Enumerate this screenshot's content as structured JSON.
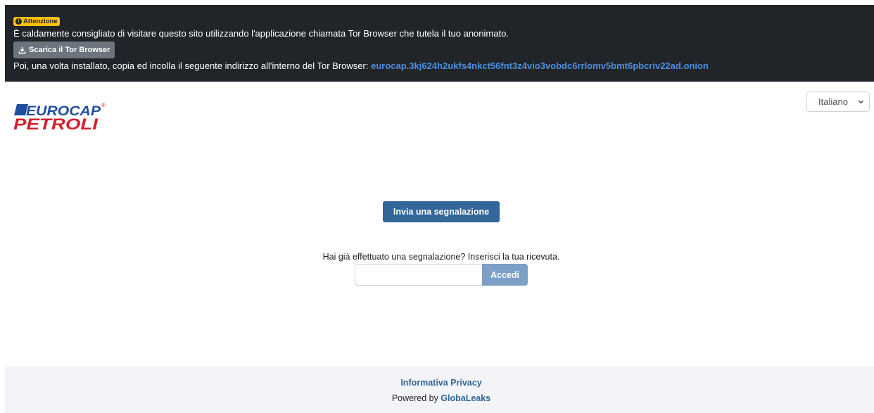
{
  "banner": {
    "badge_label": "Attenzione",
    "message": "È caldamente consigliato di visitare questo sito utilizzando l'applicazione chiamata Tor Browser che tutela il tuo anonimato.",
    "download_button": "Scarica il Tor Browser",
    "instruction": "Poi, una volta installato, copia ed incolla il seguente indirizzo all'interno del Tor Browser: ",
    "onion_address": "eurocap.3kj624h2ukfs4nkct56fnt3z4vio3vobdc6rrlomv5bmt6pbcriv22ad.onion",
    "icons": {
      "badge": "exclamation-circle-icon",
      "download": "download-icon"
    }
  },
  "header": {
    "logo": {
      "line1": "EUROCAP",
      "line2": "PETROLI",
      "mark": "®"
    },
    "language": {
      "selected": "Italiano",
      "icon": "chevron-down-icon"
    }
  },
  "main": {
    "submit_button": "Invia una segnalazione",
    "receipt_prompt": "Hai già effettuato una segnalazione? Inserisci la tua ricevuta.",
    "receipt_input_value": "",
    "login_button": "Accedi"
  },
  "footer": {
    "privacy_link": "Informativa Privacy",
    "powered_by": "Powered by ",
    "powered_by_link": "GlobaLeaks"
  },
  "colors": {
    "banner_bg": "#212529",
    "badge": "#ffc107",
    "onion_link": "#4d8fe0",
    "primary": "#336699",
    "login_disabled": "#7b9fc6",
    "footer_bg": "#f2f4f7",
    "logo_blue": "#1f4e9e",
    "logo_red": "#d5202e"
  }
}
